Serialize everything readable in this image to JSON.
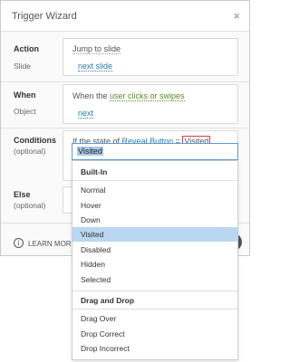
{
  "dialog": {
    "title": "Trigger Wizard",
    "close": "×"
  },
  "action": {
    "label": "Action",
    "sublabel": "Slide",
    "value": "Jump to slide",
    "target": "next slide"
  },
  "when": {
    "label": "When",
    "sublabel": "Object",
    "prefix": "When the ",
    "event": "user clicks or swipes",
    "object": "next"
  },
  "conditions": {
    "label": "Conditions",
    "sublabel": "(optional)",
    "prefix": "If the state of ",
    "object": "Reveal Button",
    "op": " = ",
    "state": "Visited",
    "input_value": "Visited"
  },
  "else": {
    "label": "Else",
    "sublabel": "(optional)"
  },
  "dropdown": {
    "group1": "Built-In",
    "items1": [
      "Normal",
      "Hover",
      "Down",
      "Visited",
      "Disabled",
      "Hidden",
      "Selected"
    ],
    "selected": "Visited",
    "group2": "Drag and Drop",
    "items2": [
      "Drag Over",
      "Drop Correct",
      "Drop Incorrect"
    ]
  },
  "footer": {
    "learn": "LEARN MORE",
    "info_icon": "i"
  }
}
